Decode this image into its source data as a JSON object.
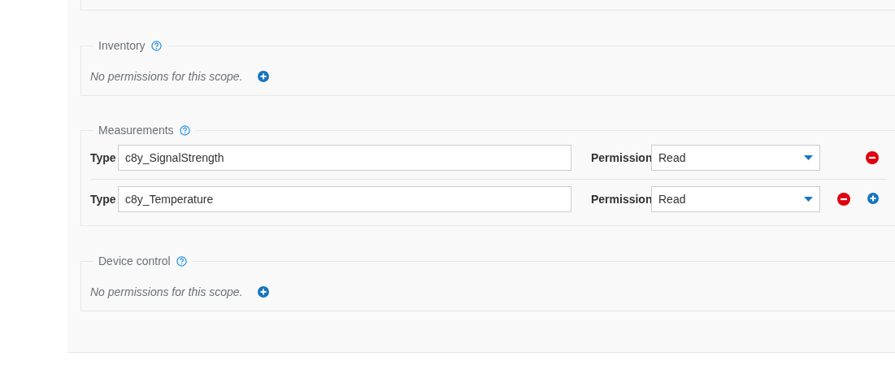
{
  "sections": [
    {
      "kind": "empty",
      "title": "Inventory",
      "message": "No permissions for this scope."
    },
    {
      "kind": "rules",
      "title": "Measurements",
      "rules": [
        {
          "type_label": "Type",
          "type": "c8y_SignalStrength",
          "permission_label": "Permission",
          "permission": "Read",
          "can_add": false
        },
        {
          "type_label": "Type",
          "type": "c8y_Temperature",
          "permission_label": "Permission",
          "permission": "Read",
          "can_add": true
        }
      ]
    },
    {
      "kind": "empty",
      "title": "Device control",
      "message": "No permissions for this scope."
    }
  ]
}
